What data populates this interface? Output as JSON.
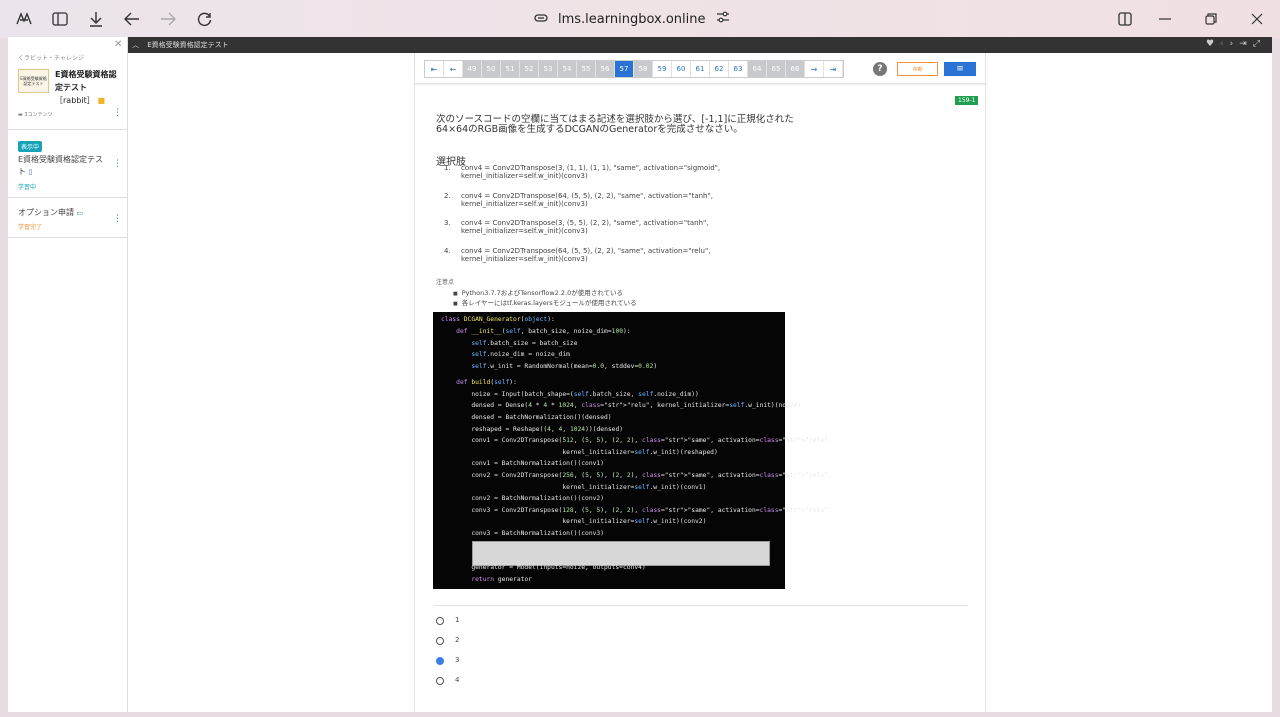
{
  "browser": {
    "url": "lms.learningbox.online"
  },
  "sidebar": {
    "breadcrumb": "くラビット・チャレンジ",
    "thumb_text": "E資格受験資格\n認定テスト",
    "course_title": "E資格受験資格認定テスト",
    "course_suffix": "［rabbit］",
    "content_count": "3コンテンツ",
    "badge": "表示中",
    "items": [
      {
        "title": "E資格受験資格認定テスト",
        "status": "学習中"
      },
      {
        "title": "オプション申請",
        "status": "学習完了"
      }
    ]
  },
  "viewer": {
    "title": "E資格受験資格認定テスト"
  },
  "pager": {
    "pages": [
      "49",
      "50",
      "51",
      "52",
      "53",
      "54",
      "55",
      "56",
      "57",
      "58",
      "59",
      "60",
      "61",
      "62",
      "63",
      "64",
      "65",
      "66"
    ],
    "done": [
      "49",
      "50",
      "51",
      "52",
      "53",
      "54",
      "55",
      "56",
      "58",
      "64",
      "65",
      "66"
    ],
    "current": "57",
    "suspend_label": "中断",
    "menu_label": "≡"
  },
  "question": {
    "id": "159-1",
    "text_line1": "次のソースコードの空欄に当てはまる記述を選択肢から選び、[-1,1]に正規化された",
    "text_line2": "64×64のRGB画像を生成するDCGANのGeneratorを完成させなさい。",
    "choices_heading": "選択肢",
    "choices": [
      {
        "num": "1.",
        "line1": "conv4 = Conv2DTranspose(3, (1, 1), (1, 1), \"same\", activation=\"sigmoid\",",
        "line2": "kernel_initializer=self.w_init)(conv3)"
      },
      {
        "num": "2.",
        "line1": "conv4 = Conv2DTranspose(64, (5, 5), (2, 2), \"same\", activation=\"tanh\",",
        "line2": "kernel_initializer=self.w_init)(conv3)"
      },
      {
        "num": "3.",
        "line1": "conv4 = Conv2DTranspose(3, (5, 5), (2, 2), \"same\", activation=\"tanh\",",
        "line2": "kernel_initializer=self.w_init)(conv3)"
      },
      {
        "num": "4.",
        "line1": "conv4 = Conv2DTranspose(64, (5, 5), (2, 2), \"same\", activation=\"relu\",",
        "line2": "kernel_initializer=self.w_init)(conv3)"
      }
    ],
    "notes_heading": "注意点",
    "notes": [
      "Python3.7.7およびTensorflow2.2.0が使用されている",
      "各レイヤーにはtf.keras.layersモジュールが使用されている"
    ]
  },
  "code_lines": [
    "class DCGAN_Generator(object):",
    "    def __init__(self, batch_size, noize_dim=100):",
    "        self.batch_size = batch_size",
    "        self.noize_dim = noize_dim",
    "        self.w_init = RandomNormal(mean=0.0, stddev=0.02)",
    "    def build(self):",
    "        noize = Input(batch_shape=(self.batch_size, self.noize_dim))",
    "        densed = Dense(4 * 4 * 1024, \"relu\", kernel_initializer=self.w_init)(noize)",
    "        densed = BatchNormalization()(densed)",
    "        reshaped = Reshape((4, 4, 1024))(densed)",
    "        conv1 = Conv2DTranspose(512, (5, 5), (2, 2), \"same\", activation=\"relu\",",
    "                                kernel_initializer=self.w_init)(reshaped)",
    "        conv1 = BatchNormalization()(conv1)",
    "        conv2 = Conv2DTranspose(256, (5, 5), (2, 2), \"same\", activation=\"relu\",",
    "                                kernel_initializer=self.w_init)(conv1)",
    "        conv2 = BatchNormalization()(conv2)",
    "        conv3 = Conv2DTranspose(128, (5, 5), (2, 2), \"same\", activation=\"relu\",",
    "                                kernel_initializer=self.w_init)(conv2)",
    "        conv3 = BatchNormalization()(conv3)",
    "        generator = Model(inputs=noize, outputs=conv4)",
    "        return generator"
  ],
  "answers": {
    "options": [
      "1",
      "2",
      "3",
      "4"
    ],
    "selected": "3"
  }
}
